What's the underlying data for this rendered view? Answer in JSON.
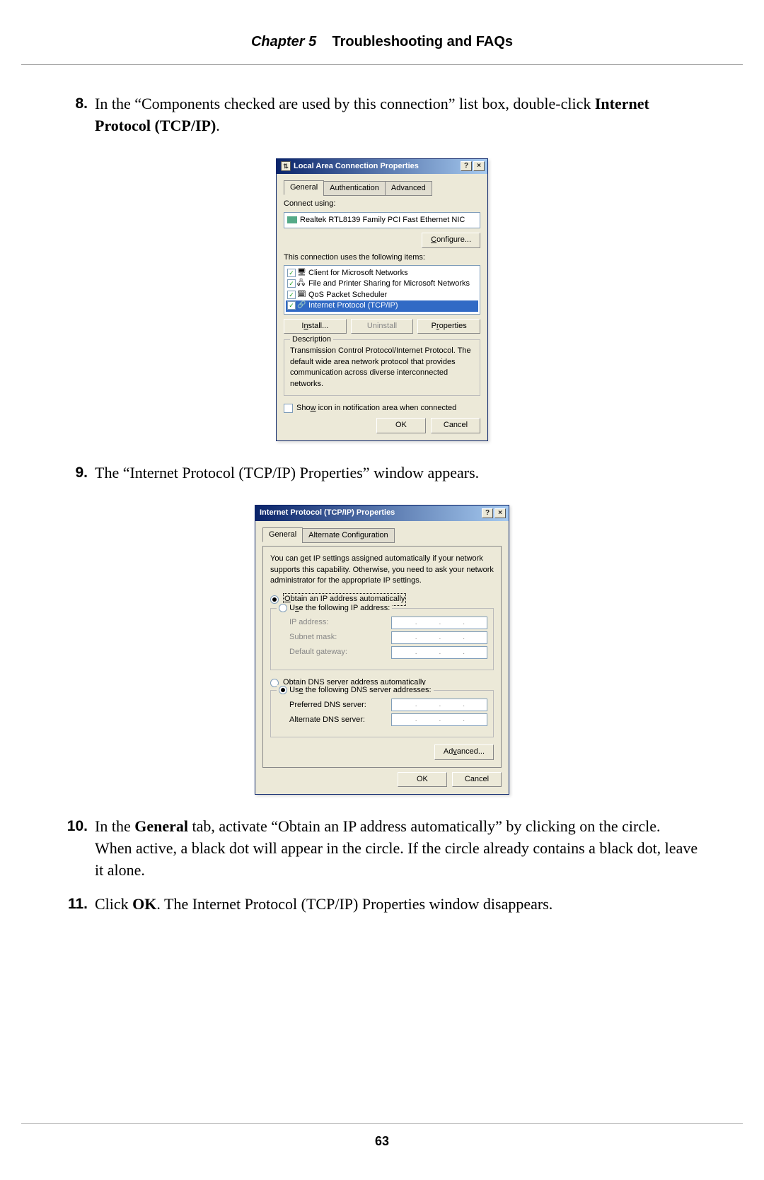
{
  "header": {
    "chapter_label": "Chapter 5",
    "chapter_title": "Troubleshooting and FAQs"
  },
  "steps": {
    "s8": {
      "num": "8.",
      "text_a": "In the “Components checked are used by this connection” list box, double-click ",
      "text_bold": "Internet Protocol",
      "text_sc": " (TCP/IP)",
      "text_end": "."
    },
    "s9": {
      "num": "9.",
      "text": "The “Internet Protocol (TCP/IP) Properties” window appears."
    },
    "s10": {
      "num": "10.",
      "text_a": "In the ",
      "text_bold": "General",
      "text_b": " tab, activate “Obtain an IP address automatically” by clicking on the circle. When active, a black dot will appear in the circle. If the circle already contains a black dot, leave it alone."
    },
    "s11": {
      "num": "11.",
      "text_a": "Click ",
      "text_bold": "OK",
      "text_b": ". The Internet Protocol (TCP/IP) Properties window disappears."
    }
  },
  "dialog1": {
    "title": "Local Area Connection Properties",
    "help": "?",
    "close": "×",
    "tabs": {
      "general": "General",
      "auth": "Authentication",
      "adv": "Advanced"
    },
    "connect_using_lbl": "Connect using:",
    "adapter": "Realtek RTL8139 Family PCI Fast Ethernet NIC",
    "configure_btn": "Configure...",
    "uses_lbl": "This connection uses the following items:",
    "items": {
      "i1": "Client for Microsoft Networks",
      "i2": "File and Printer Sharing for Microsoft Networks",
      "i3": "QoS Packet Scheduler",
      "i4": "Internet Protocol (TCP/IP)"
    },
    "install_btn": "Install...",
    "uninstall_btn": "Uninstall",
    "properties_btn": "Properties",
    "desc_legend": "Description",
    "desc_text": "Transmission Control Protocol/Internet Protocol. The default wide area network protocol that provides communication across diverse interconnected networks.",
    "showicon": "Show icon in notification area when connected",
    "ok": "OK",
    "cancel": "Cancel"
  },
  "dialog2": {
    "title": "Internet Protocol (TCP/IP) Properties",
    "help": "?",
    "close": "×",
    "tabs": {
      "general": "General",
      "alt": "Alternate Configuration"
    },
    "intro": "You can get IP settings assigned automatically if your network supports this capability. Otherwise, you need to ask your network administrator for the appropriate IP settings.",
    "r_auto_ip": "Obtain an IP address automatically",
    "r_use_ip": "Use the following IP address:",
    "ip_lbl": "IP address:",
    "subnet_lbl": "Subnet mask:",
    "gateway_lbl": "Default gateway:",
    "r_auto_dns": "Obtain DNS server address automatically",
    "r_use_dns": "Use the following DNS server addresses:",
    "pref_dns_lbl": "Preferred DNS server:",
    "alt_dns_lbl": "Alternate DNS server:",
    "advanced_btn": "Advanced...",
    "ok": "OK",
    "cancel": "Cancel"
  },
  "footer": {
    "page_num": "63"
  }
}
